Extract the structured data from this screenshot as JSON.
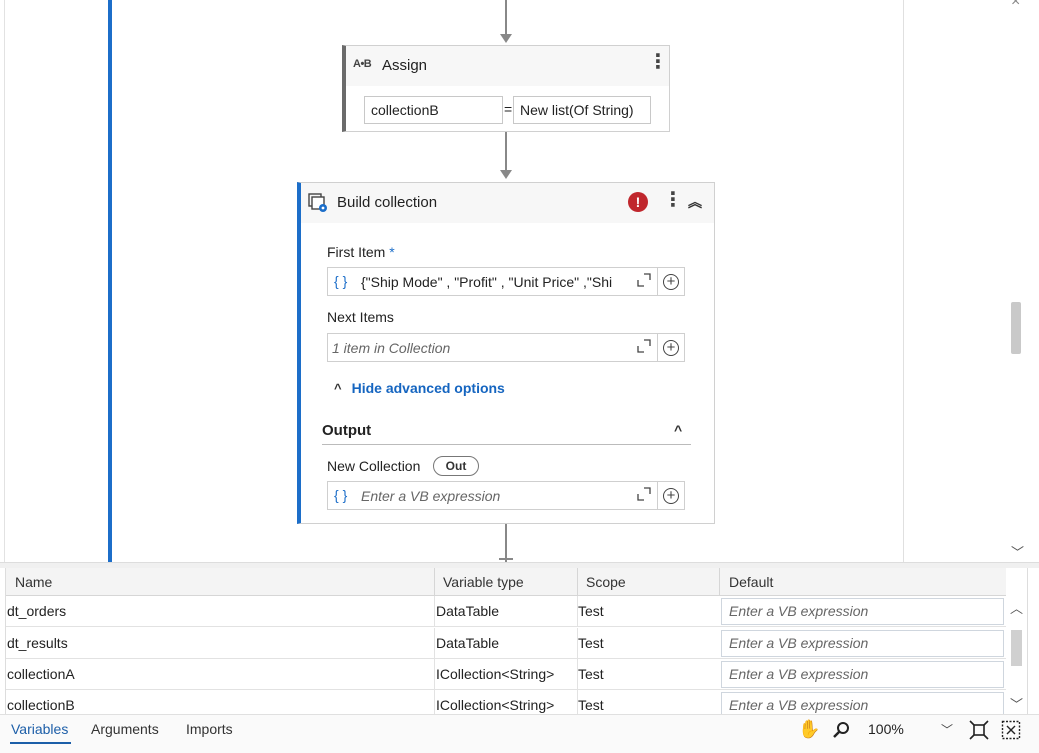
{
  "assign": {
    "title": "Assign",
    "icon": "A•B",
    "left_value": "collectionB",
    "equals": "=",
    "right_value": "New list(Of String)"
  },
  "build_collection": {
    "title": "Build collection",
    "error_badge": "!",
    "first_item_label": "First Item",
    "first_item_required": "*",
    "first_item_value": "{\"Ship Mode\" , \"Profit\" , \"Unit Price\" ,\"Shi",
    "next_items_label": "Next Items",
    "next_items_placeholder": "1 item in Collection",
    "advanced_toggle": "Hide advanced options",
    "output_section": "Output",
    "new_collection_label": "New Collection",
    "direction_pill": "Out",
    "new_collection_placeholder": "Enter a VB expression",
    "curly_glyph": "{ }"
  },
  "variables": {
    "columns": [
      "Name",
      "Variable type",
      "Scope",
      "Default"
    ],
    "rows": [
      {
        "name": "dt_orders",
        "type": "DataTable",
        "scope": "Test",
        "default_placeholder": "Enter a VB expression"
      },
      {
        "name": "dt_results",
        "type": "DataTable",
        "scope": "Test",
        "default_placeholder": "Enter a VB expression"
      },
      {
        "name": "collectionA",
        "type": "ICollection<String>",
        "scope": "Test",
        "default_placeholder": "Enter a VB expression"
      },
      {
        "name": "collectionB",
        "type": "ICollection<String>",
        "scope": "Test",
        "default_placeholder": "Enter a VB expression"
      }
    ]
  },
  "bottom_bar": {
    "tabs": [
      "Variables",
      "Arguments",
      "Imports"
    ],
    "active_tab": "Variables",
    "zoom": "100%"
  },
  "colors": {
    "accent": "#1c6ec9",
    "error": "#c0272d",
    "link": "#1565c0"
  },
  "icons": [
    "hand-pan-icon",
    "zoom-search-icon",
    "fit-to-screen-icon",
    "overview-icon",
    "kebab-menu-icon",
    "collapse-icon",
    "expand-editor-icon",
    "add-icon",
    "error-icon"
  ]
}
